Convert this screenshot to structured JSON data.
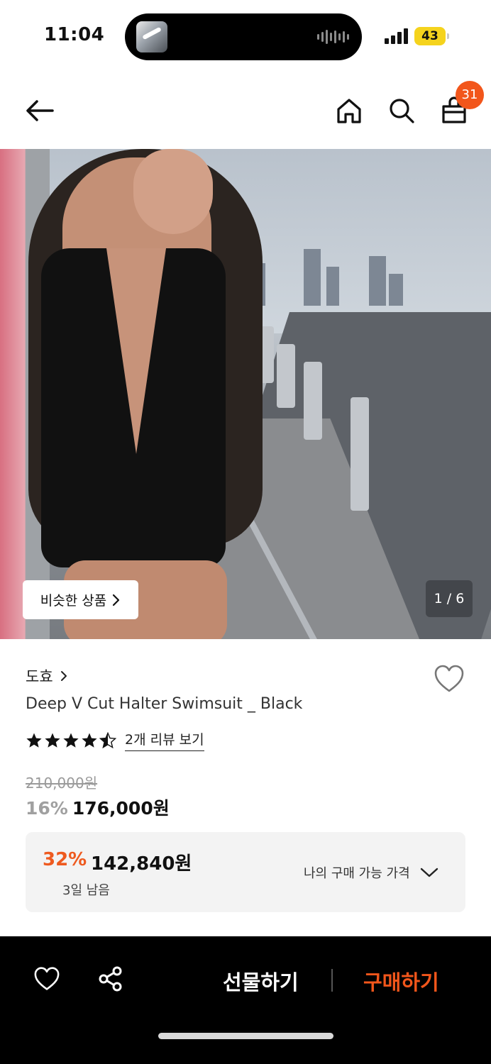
{
  "status_bar": {
    "time": "11:04",
    "battery": "43"
  },
  "nav": {
    "cart_count": "31"
  },
  "gallery": {
    "similar_label": "비슷한 상품",
    "page_indicator": "1 / 6"
  },
  "product": {
    "brand": "도효",
    "title": "Deep V Cut Halter Swimsuit _ Black",
    "rating": 4.5,
    "review_link": "2개 리뷰 보기",
    "original_price": "210,000원",
    "discount": "16%",
    "price": "176,000원"
  },
  "coupon": {
    "discount": "32%",
    "price": "142,840원",
    "remaining": "3일 남음",
    "toggle_label": "나의 구매 가능 가격"
  },
  "bottom_bar": {
    "gift_label": "선물하기",
    "buy_label": "구매하기"
  },
  "colors": {
    "accent": "#f2561b",
    "badge": "#f2561b",
    "coupon_discount": "#ee5a1f"
  },
  "icons": [
    "back-arrow-icon",
    "home-icon",
    "search-icon",
    "cart-icon",
    "chevron-right-icon",
    "heart-icon",
    "star-icon",
    "chevron-down-icon",
    "share-icon"
  ]
}
